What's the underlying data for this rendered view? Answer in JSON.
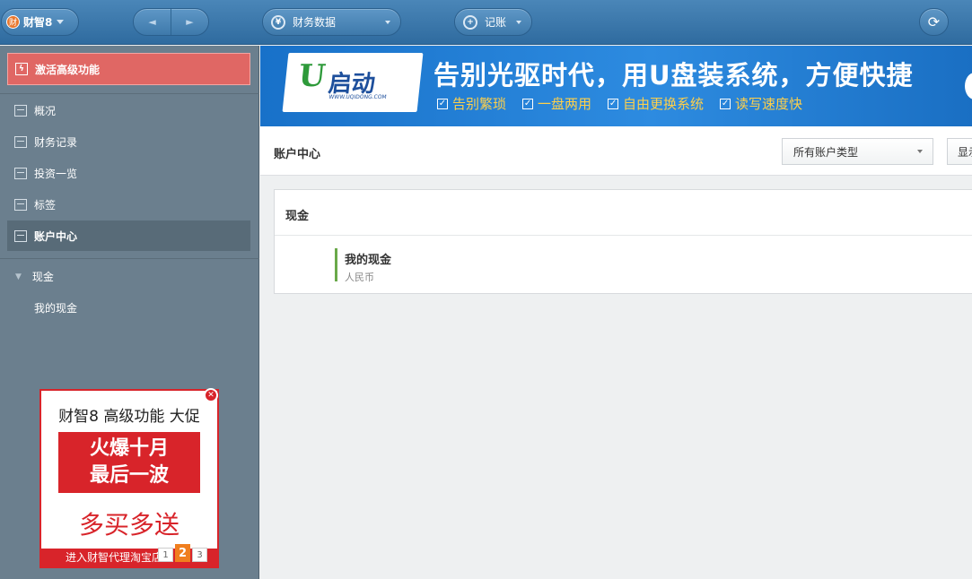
{
  "topbar": {
    "brand_logo_glyph": "财",
    "brand_name": "财智8",
    "back_glyph": "◄",
    "forward_glyph": "►",
    "finance_icon_glyph": "¥",
    "finance_label": "财务数据",
    "add_icon_glyph": "+",
    "add_label": "记账",
    "refresh_glyph": "⟳"
  },
  "sidebar": {
    "activate_label": "激活高级功能",
    "activate_icon_glyph": "ϟ",
    "items": [
      {
        "label": "概况",
        "icon": "overview-icon"
      },
      {
        "label": "财务记录",
        "icon": "calendar-icon"
      },
      {
        "label": "投资一览",
        "icon": "chart-icon"
      },
      {
        "label": "标签",
        "icon": "tag-icon"
      },
      {
        "label": "账户中心",
        "icon": "account-icon"
      }
    ],
    "category_chevron": "▼",
    "category_label": "现金",
    "sub_item_label": "我的现金"
  },
  "promo": {
    "title": "财智8 高级功能 大促",
    "box_line1": "火爆十月",
    "box_line2": "最后一波",
    "big_text": "多买多送",
    "footer": "进入财智代理淘宝店",
    "close_glyph": "✕",
    "pages": [
      "1",
      "2",
      "3"
    ],
    "current_page": "2"
  },
  "banner": {
    "logo_u": "U",
    "logo_text": "启动",
    "logo_url": "WWW.UQIDONG.COM",
    "headline": "告别光驱时代，用U盘装系统，方便快捷",
    "check_glyph": "✓",
    "checks": [
      "告别繁琐",
      "一盘两用",
      "自由更换系统",
      "读写速度快"
    ]
  },
  "content": {
    "title": "账户中心",
    "type_select_value": "所有账户类型",
    "show_button_label": "显示",
    "panel_title": "现金",
    "account_name": "我的现金",
    "account_currency": "人民币"
  },
  "colors": {
    "topbar": "#3a78ad",
    "sidebar": "#6b7f8e",
    "activate": "#e06764",
    "promo_red": "#d8242a",
    "account_accent": "#6aa94a"
  }
}
